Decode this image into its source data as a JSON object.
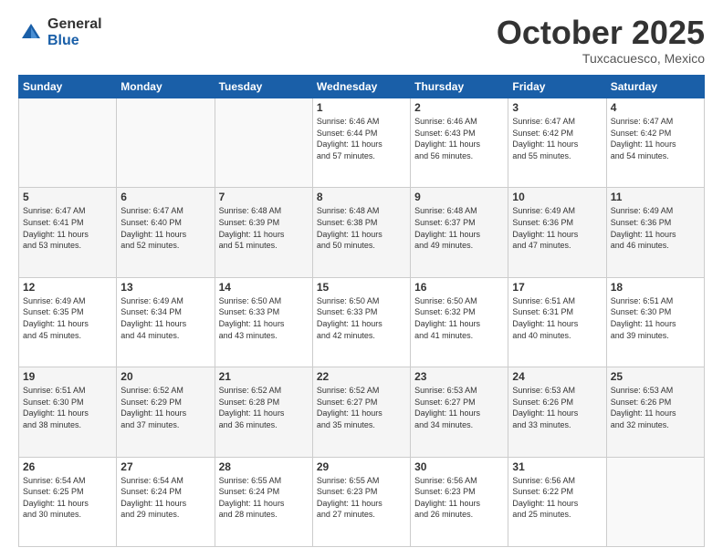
{
  "header": {
    "logo_general": "General",
    "logo_blue": "Blue",
    "month_title": "October 2025",
    "subtitle": "Tuxcacuesco, Mexico"
  },
  "days_of_week": [
    "Sunday",
    "Monday",
    "Tuesday",
    "Wednesday",
    "Thursday",
    "Friday",
    "Saturday"
  ],
  "weeks": [
    [
      {
        "num": "",
        "info": ""
      },
      {
        "num": "",
        "info": ""
      },
      {
        "num": "",
        "info": ""
      },
      {
        "num": "1",
        "info": "Sunrise: 6:46 AM\nSunset: 6:44 PM\nDaylight: 11 hours\nand 57 minutes."
      },
      {
        "num": "2",
        "info": "Sunrise: 6:46 AM\nSunset: 6:43 PM\nDaylight: 11 hours\nand 56 minutes."
      },
      {
        "num": "3",
        "info": "Sunrise: 6:47 AM\nSunset: 6:42 PM\nDaylight: 11 hours\nand 55 minutes."
      },
      {
        "num": "4",
        "info": "Sunrise: 6:47 AM\nSunset: 6:42 PM\nDaylight: 11 hours\nand 54 minutes."
      }
    ],
    [
      {
        "num": "5",
        "info": "Sunrise: 6:47 AM\nSunset: 6:41 PM\nDaylight: 11 hours\nand 53 minutes."
      },
      {
        "num": "6",
        "info": "Sunrise: 6:47 AM\nSunset: 6:40 PM\nDaylight: 11 hours\nand 52 minutes."
      },
      {
        "num": "7",
        "info": "Sunrise: 6:48 AM\nSunset: 6:39 PM\nDaylight: 11 hours\nand 51 minutes."
      },
      {
        "num": "8",
        "info": "Sunrise: 6:48 AM\nSunset: 6:38 PM\nDaylight: 11 hours\nand 50 minutes."
      },
      {
        "num": "9",
        "info": "Sunrise: 6:48 AM\nSunset: 6:37 PM\nDaylight: 11 hours\nand 49 minutes."
      },
      {
        "num": "10",
        "info": "Sunrise: 6:49 AM\nSunset: 6:36 PM\nDaylight: 11 hours\nand 47 minutes."
      },
      {
        "num": "11",
        "info": "Sunrise: 6:49 AM\nSunset: 6:36 PM\nDaylight: 11 hours\nand 46 minutes."
      }
    ],
    [
      {
        "num": "12",
        "info": "Sunrise: 6:49 AM\nSunset: 6:35 PM\nDaylight: 11 hours\nand 45 minutes."
      },
      {
        "num": "13",
        "info": "Sunrise: 6:49 AM\nSunset: 6:34 PM\nDaylight: 11 hours\nand 44 minutes."
      },
      {
        "num": "14",
        "info": "Sunrise: 6:50 AM\nSunset: 6:33 PM\nDaylight: 11 hours\nand 43 minutes."
      },
      {
        "num": "15",
        "info": "Sunrise: 6:50 AM\nSunset: 6:33 PM\nDaylight: 11 hours\nand 42 minutes."
      },
      {
        "num": "16",
        "info": "Sunrise: 6:50 AM\nSunset: 6:32 PM\nDaylight: 11 hours\nand 41 minutes."
      },
      {
        "num": "17",
        "info": "Sunrise: 6:51 AM\nSunset: 6:31 PM\nDaylight: 11 hours\nand 40 minutes."
      },
      {
        "num": "18",
        "info": "Sunrise: 6:51 AM\nSunset: 6:30 PM\nDaylight: 11 hours\nand 39 minutes."
      }
    ],
    [
      {
        "num": "19",
        "info": "Sunrise: 6:51 AM\nSunset: 6:30 PM\nDaylight: 11 hours\nand 38 minutes."
      },
      {
        "num": "20",
        "info": "Sunrise: 6:52 AM\nSunset: 6:29 PM\nDaylight: 11 hours\nand 37 minutes."
      },
      {
        "num": "21",
        "info": "Sunrise: 6:52 AM\nSunset: 6:28 PM\nDaylight: 11 hours\nand 36 minutes."
      },
      {
        "num": "22",
        "info": "Sunrise: 6:52 AM\nSunset: 6:27 PM\nDaylight: 11 hours\nand 35 minutes."
      },
      {
        "num": "23",
        "info": "Sunrise: 6:53 AM\nSunset: 6:27 PM\nDaylight: 11 hours\nand 34 minutes."
      },
      {
        "num": "24",
        "info": "Sunrise: 6:53 AM\nSunset: 6:26 PM\nDaylight: 11 hours\nand 33 minutes."
      },
      {
        "num": "25",
        "info": "Sunrise: 6:53 AM\nSunset: 6:26 PM\nDaylight: 11 hours\nand 32 minutes."
      }
    ],
    [
      {
        "num": "26",
        "info": "Sunrise: 6:54 AM\nSunset: 6:25 PM\nDaylight: 11 hours\nand 30 minutes."
      },
      {
        "num": "27",
        "info": "Sunrise: 6:54 AM\nSunset: 6:24 PM\nDaylight: 11 hours\nand 29 minutes."
      },
      {
        "num": "28",
        "info": "Sunrise: 6:55 AM\nSunset: 6:24 PM\nDaylight: 11 hours\nand 28 minutes."
      },
      {
        "num": "29",
        "info": "Sunrise: 6:55 AM\nSunset: 6:23 PM\nDaylight: 11 hours\nand 27 minutes."
      },
      {
        "num": "30",
        "info": "Sunrise: 6:56 AM\nSunset: 6:23 PM\nDaylight: 11 hours\nand 26 minutes."
      },
      {
        "num": "31",
        "info": "Sunrise: 6:56 AM\nSunset: 6:22 PM\nDaylight: 11 hours\nand 25 minutes."
      },
      {
        "num": "",
        "info": ""
      }
    ]
  ]
}
